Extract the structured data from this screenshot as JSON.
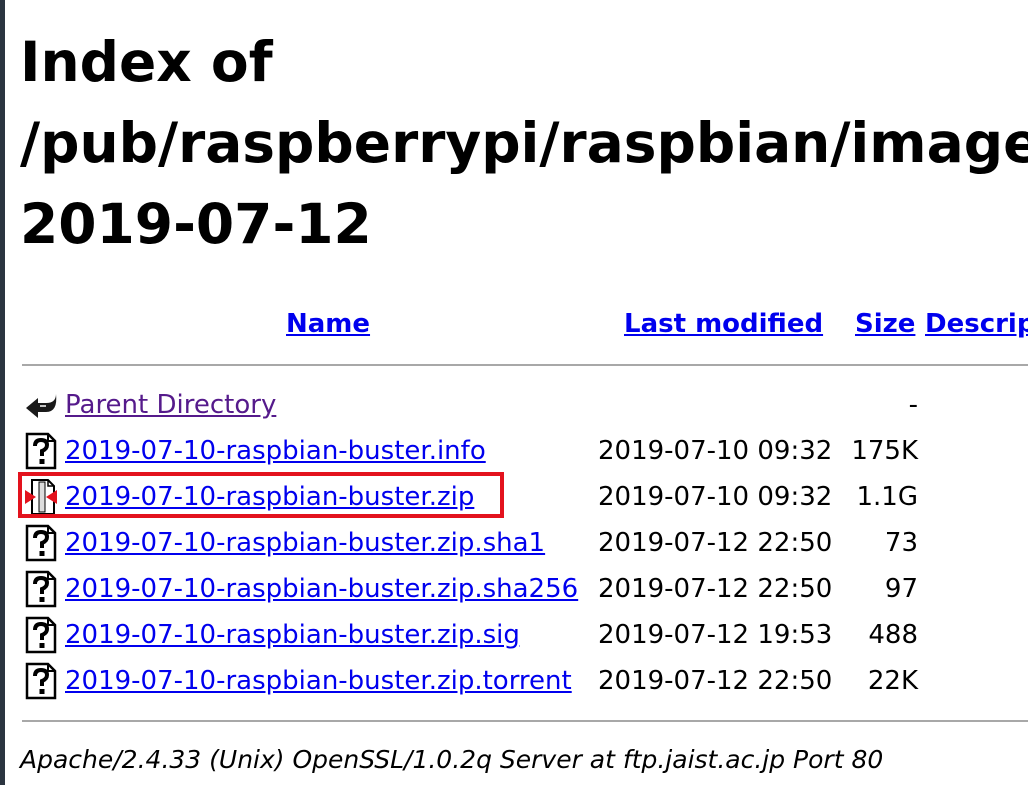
{
  "page": {
    "title_line1": "Index of",
    "title_line2": "/pub/raspberrypi/raspbian/images",
    "title_line3": "2019-07-12"
  },
  "table": {
    "headers": {
      "name": "Name",
      "last_modified": "Last modified",
      "size": "Size",
      "description": "Description"
    },
    "parent": {
      "name": "Parent Directory",
      "size": "-"
    },
    "rows": [
      {
        "name": "2019-07-10-raspbian-buster.info",
        "date": "2019-07-10 09:32",
        "size": "175K",
        "icon": "unknown-file-icon"
      },
      {
        "name": "2019-07-10-raspbian-buster.zip",
        "date": "2019-07-10 09:32",
        "size": "1.1G",
        "icon": "compressed-file-icon"
      },
      {
        "name": "2019-07-10-raspbian-buster.zip.sha1",
        "date": "2019-07-12 22:50",
        "size": "73",
        "icon": "unknown-file-icon"
      },
      {
        "name": "2019-07-10-raspbian-buster.zip.sha256",
        "date": "2019-07-12 22:50",
        "size": "97",
        "icon": "unknown-file-icon"
      },
      {
        "name": "2019-07-10-raspbian-buster.zip.sig",
        "date": "2019-07-12 19:53",
        "size": "488",
        "icon": "unknown-file-icon"
      },
      {
        "name": "2019-07-10-raspbian-buster.zip.torrent",
        "date": "2019-07-12 22:50",
        "size": "22K",
        "icon": "unknown-file-icon"
      }
    ]
  },
  "footer": {
    "text": "Apache/2.4.33 (Unix) OpenSSL/1.0.2q Server at ftp.jaist.ac.jp Port 80"
  },
  "colors": {
    "link": "#0000ee",
    "visited_link": "#551a8b",
    "highlight": "#e3121d",
    "rule": "#a8a8a8"
  }
}
